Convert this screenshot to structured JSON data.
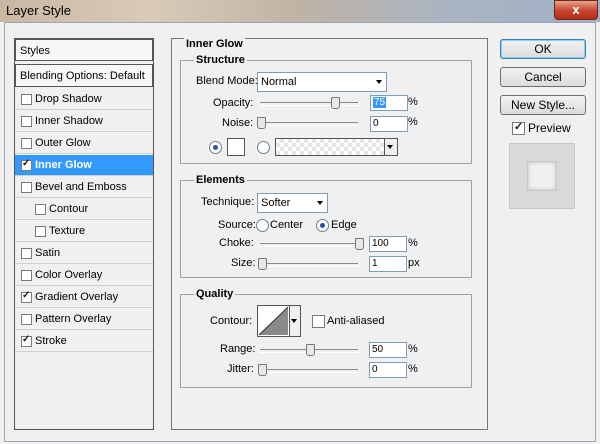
{
  "window": {
    "title": "Layer Style",
    "close_glyph": "x"
  },
  "styles_list": {
    "header": "Styles",
    "blending": "Blending Options: Default",
    "items": [
      {
        "label": "Drop Shadow",
        "checked": false
      },
      {
        "label": "Inner Shadow",
        "checked": false
      },
      {
        "label": "Outer Glow",
        "checked": false
      },
      {
        "label": "Inner Glow",
        "checked": true,
        "selected": true
      },
      {
        "label": "Bevel and Emboss",
        "checked": false
      },
      {
        "label": "Contour",
        "checked": false
      },
      {
        "label": "Texture",
        "checked": false
      },
      {
        "label": "Satin",
        "checked": false
      },
      {
        "label": "Color Overlay",
        "checked": false
      },
      {
        "label": "Gradient Overlay",
        "checked": true
      },
      {
        "label": "Pattern Overlay",
        "checked": false
      },
      {
        "label": "Stroke",
        "checked": true
      }
    ]
  },
  "panel": {
    "title": "Inner Glow",
    "structure": {
      "title": "Structure",
      "blend_mode_label": "Blend Mode:",
      "blend_mode": "Normal",
      "opacity_label": "Opacity:",
      "opacity": "75",
      "opacity_unit": "%",
      "noise_label": "Noise:",
      "noise": "0",
      "noise_unit": "%"
    },
    "elements": {
      "title": "Elements",
      "technique_label": "Technique:",
      "technique": "Softer",
      "source_label": "Source:",
      "source_center": "Center",
      "source_edge": "Edge",
      "choke_label": "Choke:",
      "choke": "100",
      "choke_unit": "%",
      "size_label": "Size:",
      "size": "1",
      "size_unit": "px"
    },
    "quality": {
      "title": "Quality",
      "contour_label": "Contour:",
      "anti_aliased_label": "Anti-aliased",
      "range_label": "Range:",
      "range": "50",
      "range_unit": "%",
      "jitter_label": "Jitter:",
      "jitter": "0",
      "jitter_unit": "%"
    }
  },
  "buttons": {
    "ok": "OK",
    "cancel": "Cancel",
    "new_style": "New Style...",
    "preview_label": "Preview"
  },
  "colors": {
    "selection": "#3399ff",
    "glow_color": "#ffffff"
  }
}
